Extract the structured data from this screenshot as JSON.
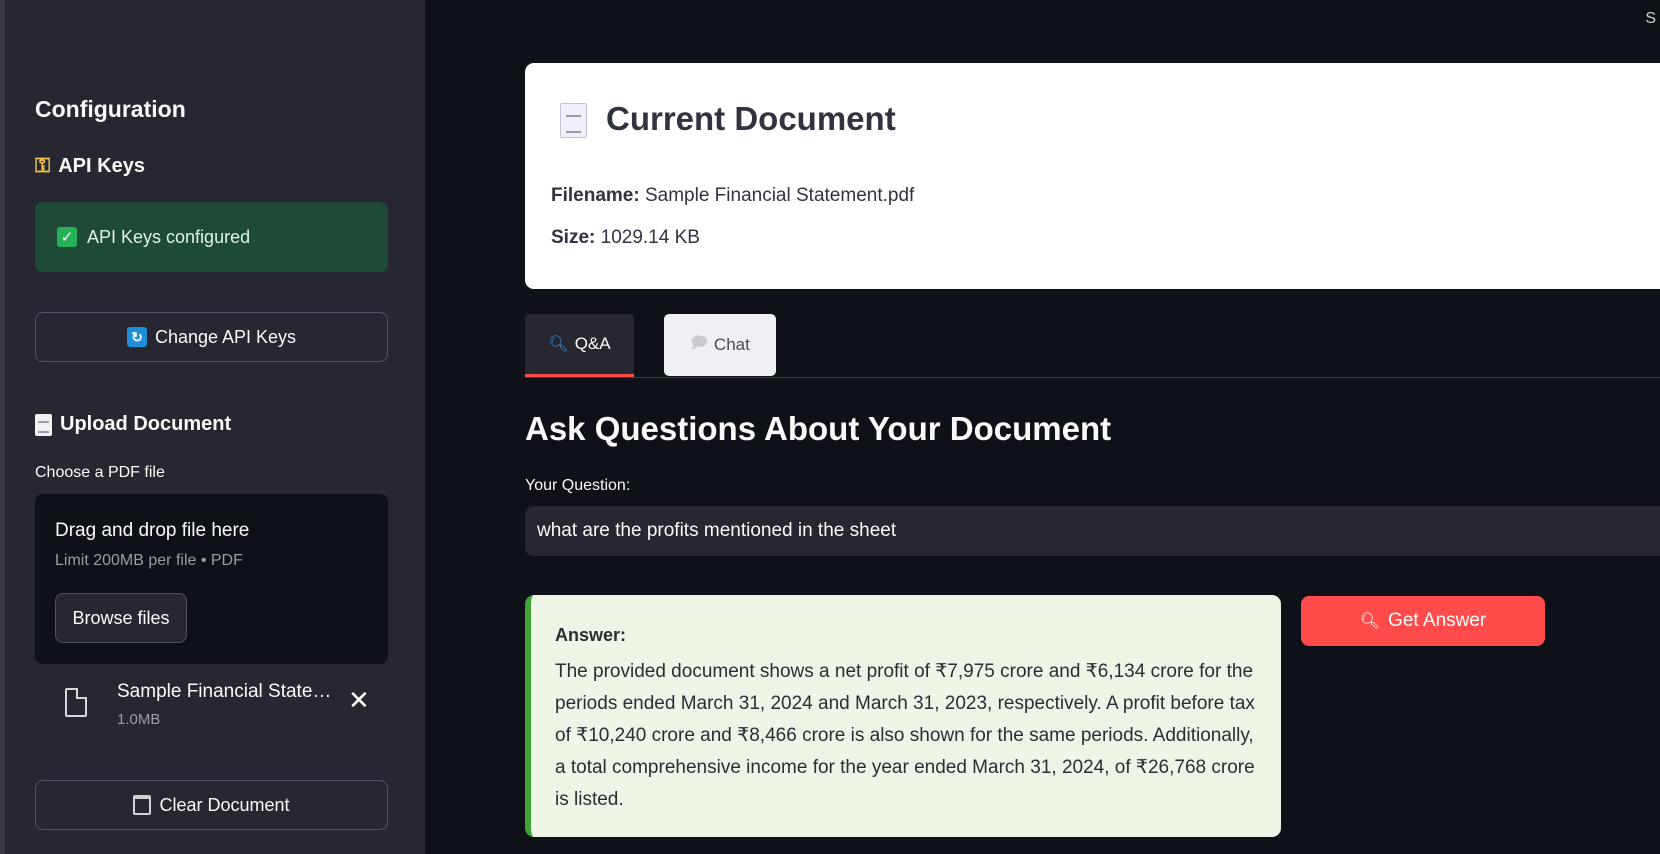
{
  "sidebar": {
    "configuration_title": "Configuration",
    "api_keys_title": "API Keys",
    "api_status": "API Keys configured",
    "change_api_keys_label": "Change API Keys",
    "upload_title": "Upload Document",
    "choose_label": "Choose a PDF file",
    "dropzone": {
      "title": "Drag and drop file here",
      "limit": "Limit 200MB per file • PDF",
      "browse_label": "Browse files"
    },
    "uploaded_file": {
      "name": "Sample Financial State…",
      "size": "1.0MB"
    },
    "clear_document_label": "Clear Document"
  },
  "main": {
    "top_right_glyph": "S",
    "document_card": {
      "title": "Current Document",
      "filename_label": "Filename:",
      "filename_value": "Sample Financial Statement.pdf",
      "size_label": "Size:",
      "size_value": "1029.14 KB"
    },
    "tabs": [
      {
        "label": "Q&A",
        "icon": "magnifier-icon",
        "active": true
      },
      {
        "label": "Chat",
        "icon": "speech-bubble-icon",
        "active": false
      }
    ],
    "qa_heading": "Ask Questions About Your Document",
    "question_label": "Your Question:",
    "question_value": "what are the profits mentioned in the sheet",
    "answer": {
      "label": "Answer:",
      "text": "The provided document shows a net profit of ₹7,975 crore and ₹6,134 crore for the periods ended March 31, 2024 and March 31, 2023, respectively. A profit before tax of ₹10,240 crore and ₹8,466 crore is also shown for the same periods. Additionally, a total comprehensive income for the year ended March 31, 2024, of ₹26,768 crore is listed."
    },
    "get_answer_label": "Get Answer"
  },
  "colors": {
    "sidebar_bg": "#262730",
    "main_bg": "#0e1117",
    "accent_red": "#ff4b4b",
    "success_bg": "#1f4a37",
    "answer_bg": "#eef5e6",
    "answer_border": "#3fa33a"
  }
}
